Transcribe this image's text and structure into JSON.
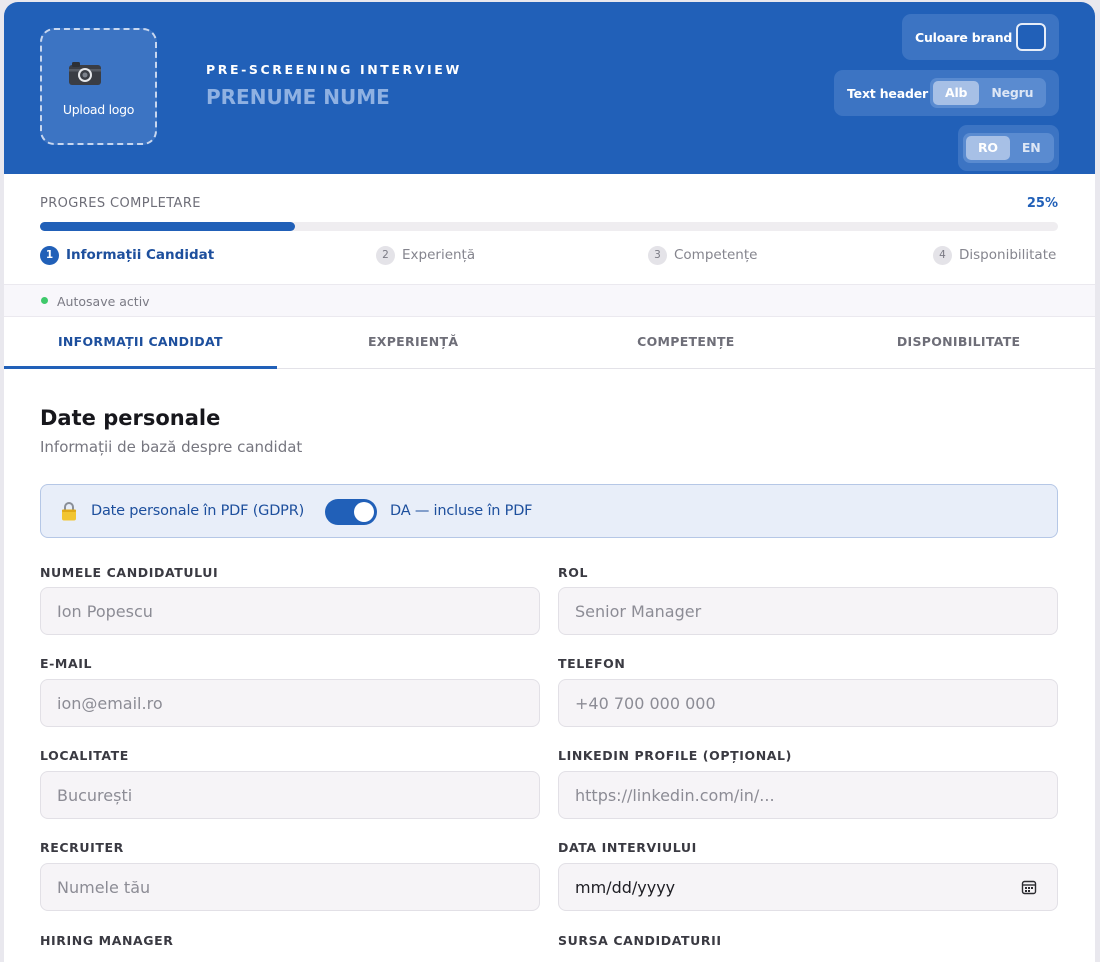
{
  "header": {
    "logo_upload_label": "Upload logo",
    "eyebrow": "PRE-SCREENING INTERVIEW",
    "candidate_name_placeholder": "PRENUME NUME",
    "brand_color_label": "Culoare brand",
    "brand_color": "#2160b8",
    "text_header_label": "Text header",
    "text_header_options": [
      "Alb",
      "Negru"
    ],
    "text_header_selected": "Alb",
    "language_options": [
      "RO",
      "EN"
    ],
    "language_selected": "RO"
  },
  "progress": {
    "label": "PROGRES COMPLETARE",
    "percent_label": "25%",
    "percent": 25,
    "steps": [
      {
        "num": "1",
        "label": "Informații Candidat",
        "active": true
      },
      {
        "num": "2",
        "label": "Experiență",
        "active": false
      },
      {
        "num": "3",
        "label": "Competențe",
        "active": false
      },
      {
        "num": "4",
        "label": "Disponibilitate",
        "active": false
      }
    ]
  },
  "autosave": {
    "label": "Autosave activ",
    "status_color": "#3fc96b"
  },
  "tabs": [
    {
      "label": "INFORMAȚII CANDIDAT",
      "active": true
    },
    {
      "label": "EXPERIENȚĂ",
      "active": false
    },
    {
      "label": "COMPETENȚE",
      "active": false
    },
    {
      "label": "DISPONIBILITATE",
      "active": false
    }
  ],
  "section": {
    "title": "Date personale",
    "subtitle": "Informații de bază despre candidat"
  },
  "gdpr": {
    "icon": "lock-icon",
    "label": "Date personale în PDF (GDPR)",
    "toggle_on": true,
    "state_label": "DA — incluse în PDF"
  },
  "fields": {
    "candidate_name": {
      "label": "NUMELE CANDIDATULUI",
      "placeholder": "Ion Popescu"
    },
    "role": {
      "label": "ROL",
      "placeholder": "Senior Manager"
    },
    "email": {
      "label": "E-MAIL",
      "placeholder": "ion@email.ro"
    },
    "phone": {
      "label": "TELEFON",
      "placeholder": "+40 700 000 000"
    },
    "city": {
      "label": "LOCALITATE",
      "placeholder": "București"
    },
    "linkedin": {
      "label": "LINKEDIN PROFILE (OPȚIONAL)",
      "placeholder": "https://linkedin.com/in/..."
    },
    "recruiter": {
      "label": "RECRUITER",
      "placeholder": "Numele tău"
    },
    "interview_date": {
      "label": "DATA INTERVIULUI",
      "value": "mm/dd/yyyy"
    },
    "hiring_manager": {
      "label": "HIRING MANAGER"
    },
    "candidate_source": {
      "label": "SURSA CANDIDATURII"
    }
  }
}
